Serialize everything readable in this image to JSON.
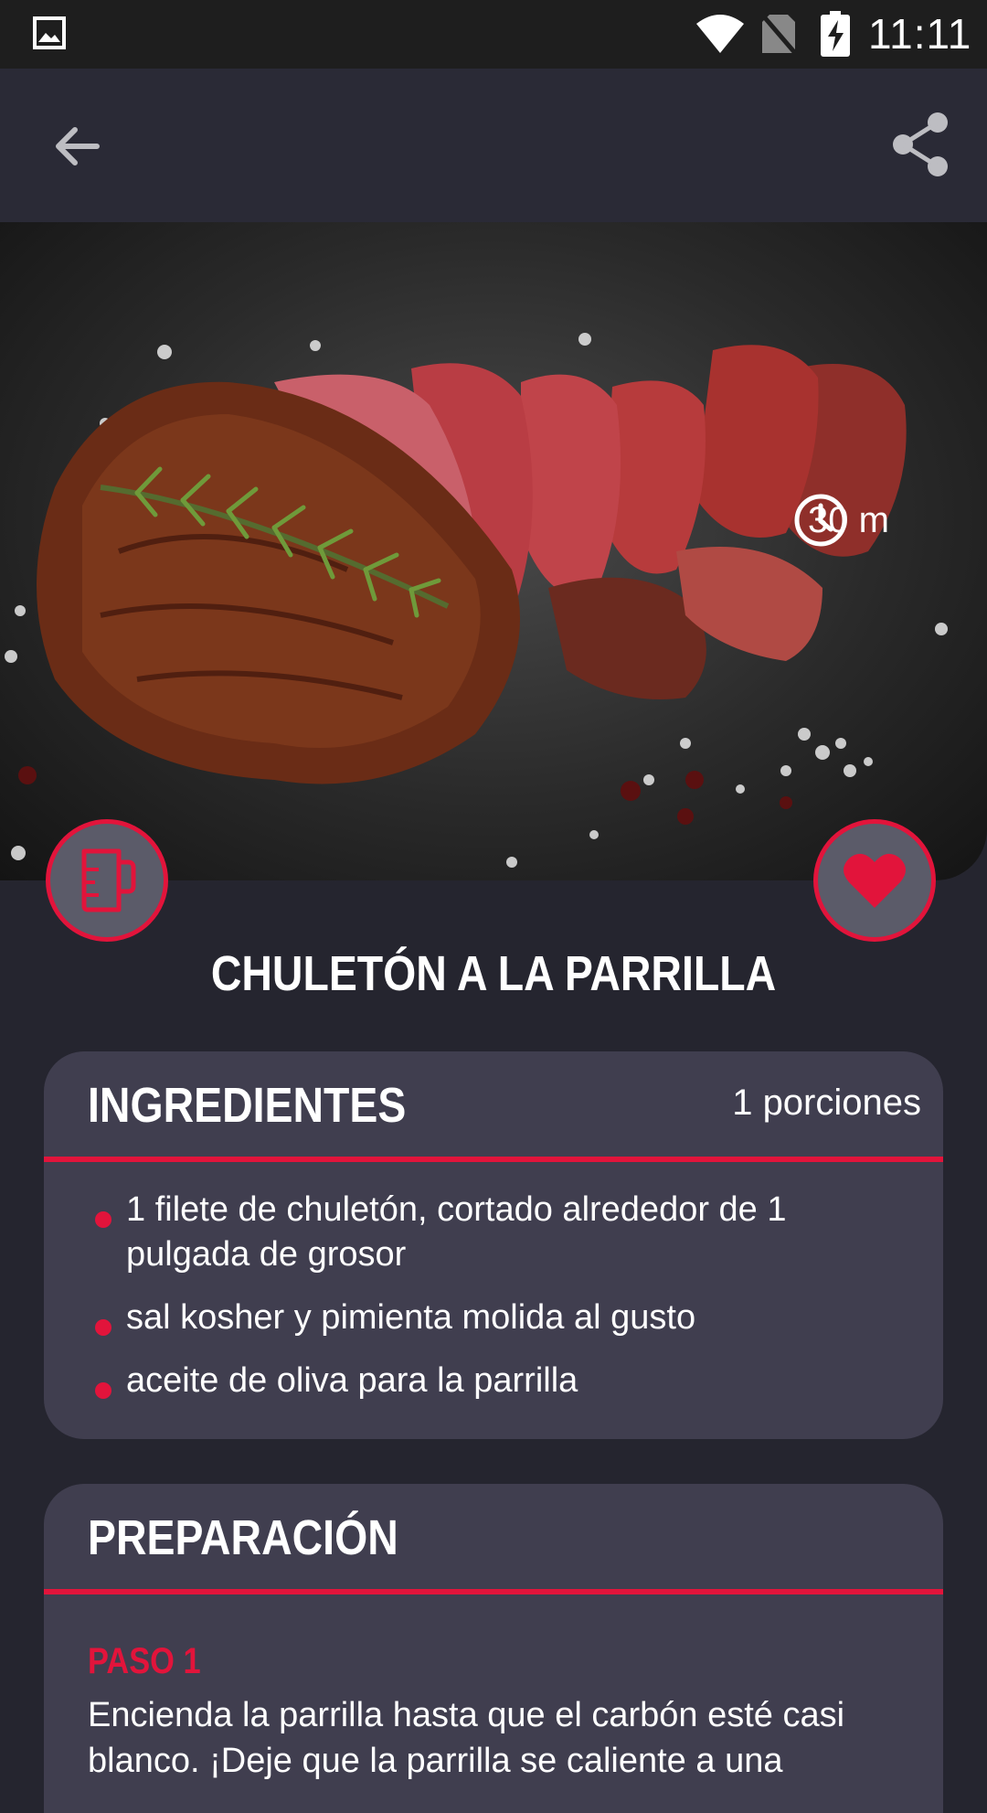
{
  "status_bar": {
    "time": "11:11",
    "icons": [
      "gallery-icon",
      "wifi-icon",
      "no-sim-icon",
      "battery-charging-icon"
    ]
  },
  "toolbar": {
    "back_icon": "arrow-back-icon",
    "share_icon": "share-icon"
  },
  "recipe": {
    "title": "CHULETÓN A LA PARRILLA",
    "time": "30 m",
    "hero_image": "grilled steak with rosemary"
  },
  "ingredients": {
    "heading": "INGREDIENTES",
    "portions": "1 porciones",
    "items": [
      "1 filete de chuletón, cortado alrededor de 1 pulgada de grosor",
      "sal kosher y pimienta molida al gusto",
      "aceite de oliva para la parrilla"
    ]
  },
  "preparation": {
    "heading": "PREPARACIÓN",
    "step_label": "PASO 1",
    "step_text": "Encienda la parrilla hasta que el carbón esté casi blanco. ¡Deje que la parrilla se caliente a una"
  },
  "colors": {
    "accent": "#e2143b",
    "background": "#25252f",
    "card": "#403e4f"
  }
}
